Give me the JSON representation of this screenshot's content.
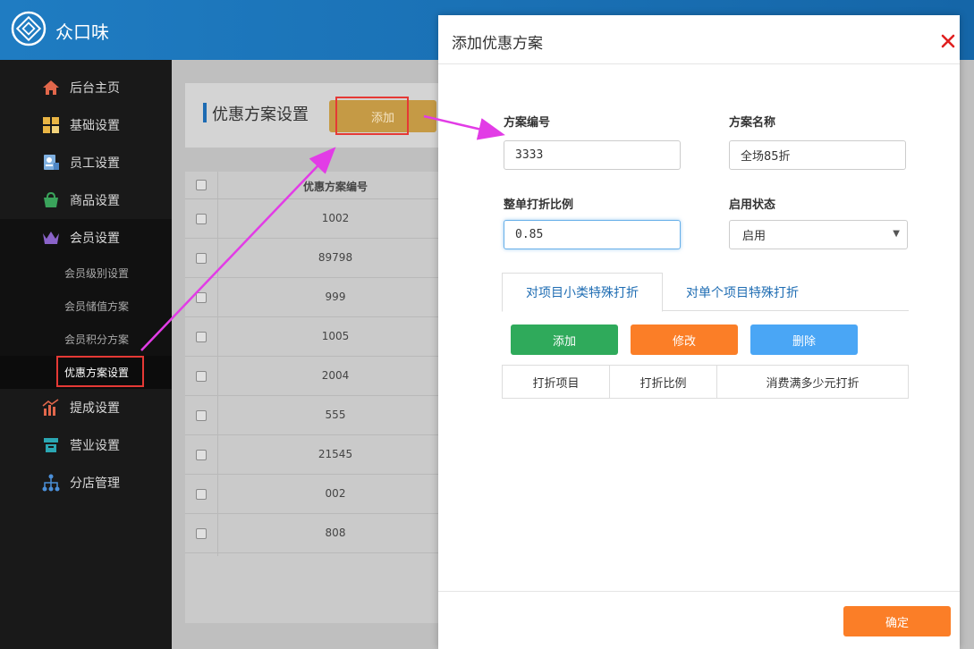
{
  "app": {
    "brand": "众口味"
  },
  "sidebar": {
    "items": [
      {
        "label": "后台主页",
        "icon": "home-icon"
      },
      {
        "label": "基础设置",
        "icon": "grid-icon"
      },
      {
        "label": "员工设置",
        "icon": "staff-icon"
      },
      {
        "label": "商品设置",
        "icon": "bag-icon"
      },
      {
        "label": "会员设置",
        "icon": "crown-icon"
      },
      {
        "label": "提成设置",
        "icon": "chart-icon"
      },
      {
        "label": "营业设置",
        "icon": "register-icon"
      },
      {
        "label": "分店管理",
        "icon": "branch-icon"
      }
    ],
    "member_sub": [
      {
        "label": "会员级别设置"
      },
      {
        "label": "会员储值方案"
      },
      {
        "label": "会员积分方案"
      },
      {
        "label": "优惠方案设置"
      }
    ]
  },
  "main": {
    "title": "优惠方案设置",
    "add_label": "添加",
    "table": {
      "header": "优惠方案编号",
      "rows": [
        "1002",
        "89798",
        "999",
        "1005",
        "2004",
        "555",
        "21545",
        "002",
        "808"
      ]
    }
  },
  "modal": {
    "title": "添加优惠方案",
    "fields": {
      "code_label": "方案编号",
      "code_value": "3333",
      "name_label": "方案名称",
      "name_value": "全场85折",
      "ratio_label": "整单打折比例",
      "ratio_value": "0.85",
      "status_label": "启用状态",
      "status_value": "启用"
    },
    "tabs": [
      {
        "label": "对项目小类特殊打折",
        "active": true
      },
      {
        "label": "对单个项目特殊打折",
        "active": false
      }
    ],
    "buttons": {
      "add": "添加",
      "edit": "修改",
      "delete": "删除",
      "confirm": "确定"
    },
    "sub_table_headers": [
      "打折项目",
      "打折比例",
      "消费满多少元打折"
    ]
  },
  "colors": {
    "header_blue": "#1f7cc2",
    "green": "#2faa5b",
    "orange": "#fb7e27",
    "blue": "#4aa6f5",
    "highlight_red": "#e53935",
    "arrow_magenta": "#e23ce6"
  }
}
